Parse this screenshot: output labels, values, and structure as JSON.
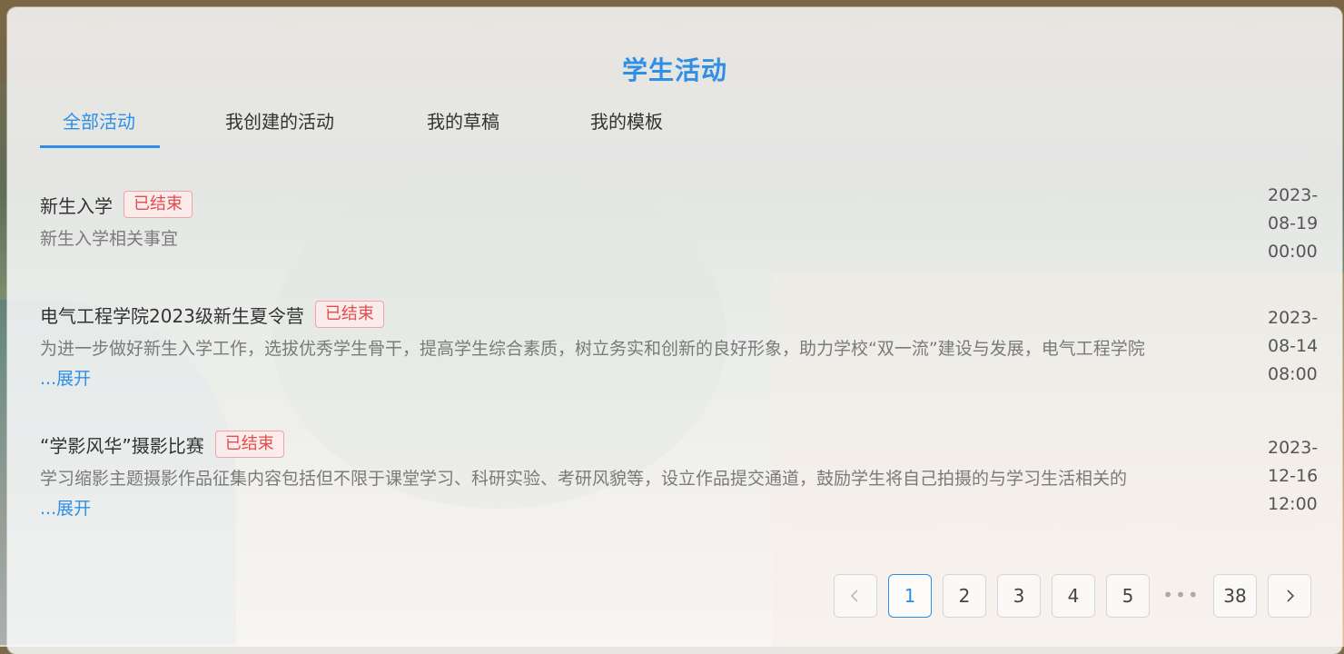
{
  "page_title": "学生活动",
  "tabs": [
    {
      "label": "全部活动",
      "active": true
    },
    {
      "label": "我创建的活动",
      "active": false
    },
    {
      "label": "我的草稿",
      "active": false
    },
    {
      "label": "我的模板",
      "active": false
    }
  ],
  "activities": [
    {
      "title": "新生入学",
      "status": "已结束",
      "description": "新生入学相关事宜",
      "expand_label": "",
      "date_year": "2023-",
      "date_md": "08-19",
      "date_time": "00:00"
    },
    {
      "title": "电气工程学院2023级新生夏令营",
      "status": "已结束",
      "description": "为进一步做好新生入学工作，选拔优秀学生骨干，提高学生综合素质，树立务实和创新的良好形象，助力学校“双一流”建设与发展，电气工程学院",
      "expand_label": "...展开",
      "date_year": "2023-",
      "date_md": "08-14",
      "date_time": "08:00"
    },
    {
      "title": "“学影风华”摄影比赛",
      "status": "已结束",
      "description": "学习缩影主题摄影作品征集内容包括但不限于课堂学习、科研实验、考研风貌等，设立作品提交通道，鼓励学生将自己拍摄的与学习生活相关的",
      "expand_label": "...展开",
      "date_year": "2023-",
      "date_md": "12-16",
      "date_time": "12:00"
    }
  ],
  "pagination": {
    "prev_icon": "chevron-left-icon",
    "next_icon": "chevron-right-icon",
    "pages": [
      "1",
      "2",
      "3",
      "4",
      "5"
    ],
    "ellipsis": "•••",
    "last_page": "38",
    "current": "1"
  },
  "colors": {
    "accent": "#2f8fe6",
    "status_ended": "#e34d4d"
  }
}
